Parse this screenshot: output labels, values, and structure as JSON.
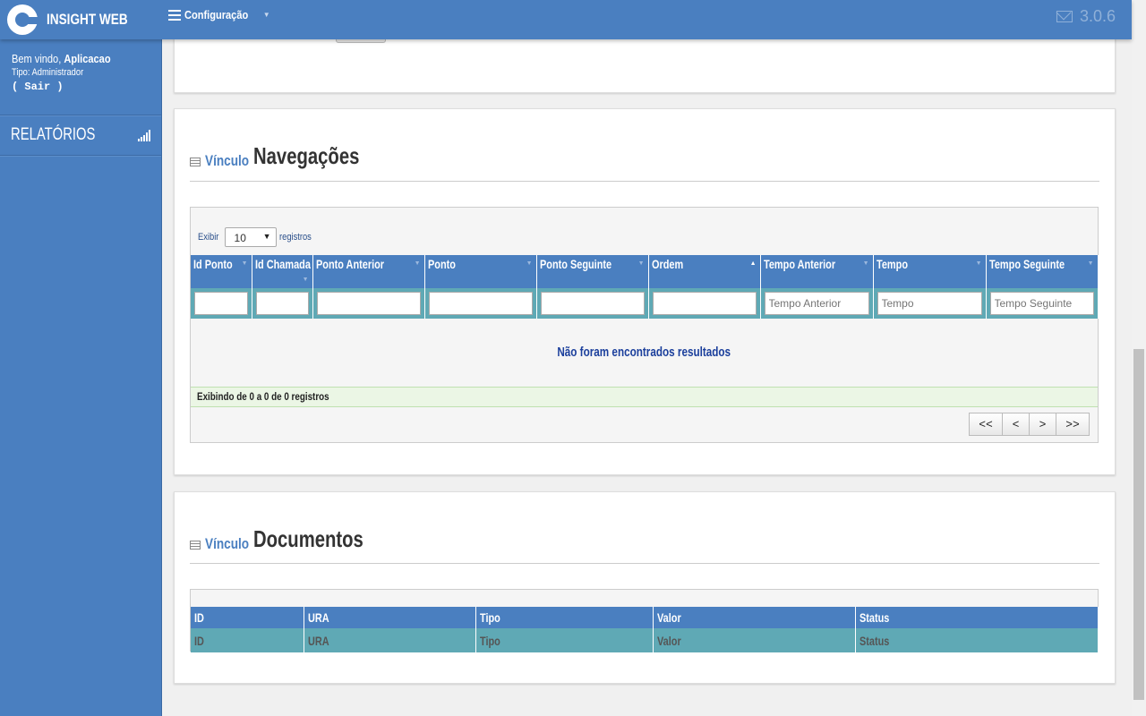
{
  "header": {
    "brand": "INSIGHT WEB",
    "menu_config": "Configuração",
    "version": "3.0.6"
  },
  "sidebar": {
    "welcome_prefix": "Bem vindo,",
    "user_name": "Aplicacao",
    "user_type": "Tipo: Administrador",
    "logout": "( Sair )",
    "reports": "RELATÓRIOS"
  },
  "navegacoes": {
    "title_sub": "Vínculo",
    "title_main": "Navegações",
    "length_label_before": "Exibir",
    "length_value": "10",
    "length_label_after": "registros",
    "columns": [
      "Id Ponto",
      "Id Chamada",
      "Ponto Anterior",
      "Ponto",
      "Ponto Seguinte",
      "Ordem",
      "Tempo Anterior",
      "Tempo",
      "Tempo Seguinte"
    ],
    "filter_placeholders": [
      "",
      "",
      "",
      "",
      "",
      "",
      "Tempo Anterior",
      "Tempo",
      "Tempo Seguinte"
    ],
    "sorted_column": "Ordem",
    "empty_message": "Não foram encontrados resultados",
    "info": "Exibindo de 0 a 0 de 0 registros",
    "pager": {
      "first": "<<",
      "prev": "<",
      "next": ">",
      "last": ">>"
    }
  },
  "documentos": {
    "title_sub": "Vínculo",
    "title_main": "Documentos",
    "columns": [
      "ID",
      "URA",
      "Tipo",
      "Valor",
      "Status"
    ],
    "row": [
      "ID",
      "URA",
      "Tipo",
      "Valor",
      "Status"
    ]
  }
}
